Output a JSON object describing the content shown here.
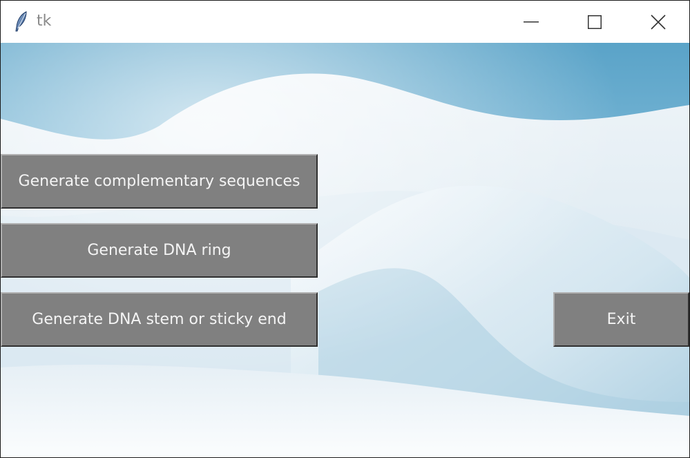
{
  "window": {
    "title": "tk",
    "icon": "tk-feather-icon"
  },
  "titlebar": {
    "minimize_icon": "minimize-icon",
    "maximize_icon": "maximize-icon",
    "close_icon": "close-icon"
  },
  "background": {
    "description_icon": "snow-background-image"
  },
  "buttons": {
    "complementary": "Generate complementary sequences",
    "ring": "Generate DNA ring",
    "stem": "Generate DNA stem or sticky end",
    "exit": "Exit"
  },
  "colors": {
    "button_bg": "#808080",
    "button_text": "#f4f4f4",
    "sky": "#6fb2d2",
    "snow": "#f2f6fa"
  }
}
